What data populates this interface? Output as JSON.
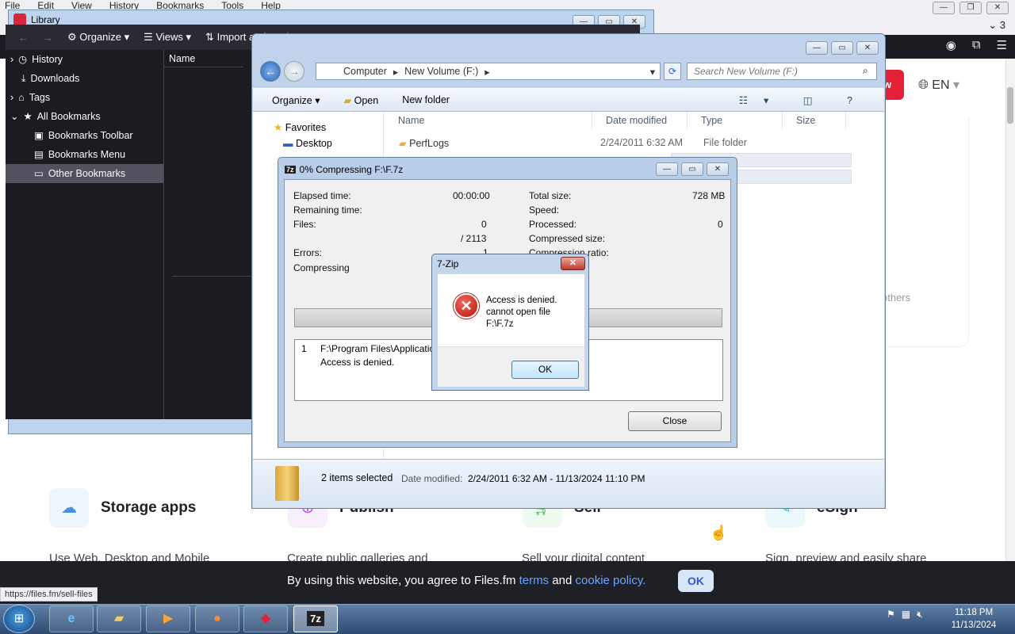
{
  "browser": {
    "menu": [
      "File",
      "Edit",
      "View",
      "History",
      "Bookmarks",
      "Tools",
      "Help"
    ],
    "tab_count": "3",
    "lang": "EN",
    "others_text": "others",
    "status_url": "https://files.fm/sell-files",
    "features": [
      {
        "title": "Storage apps",
        "desc": "Use Web, Desktop and Mobile"
      },
      {
        "title": "Publish",
        "desc": "Create public galleries and"
      },
      {
        "title": "Sell",
        "desc": "Sell your digital content"
      },
      {
        "title": "eSign",
        "desc": "Sign, preview and easily share"
      }
    ],
    "cookie": {
      "pre": "By using this website, you agree to Files.fm ",
      "terms": "terms",
      "mid": " and ",
      "policy": "cookie policy.",
      "ok": "OK"
    }
  },
  "library": {
    "title": "Library",
    "toolbar": {
      "organize": "Organize",
      "views": "Views",
      "import": "Import and Backup"
    },
    "column": "Name",
    "sidebar": [
      "History",
      "Downloads",
      "Tags",
      "All Bookmarks",
      "Bookmarks Toolbar",
      "Bookmarks Menu",
      "Other Bookmarks"
    ]
  },
  "explorer": {
    "breadcrumb": [
      "Computer",
      "New Volume (F:)"
    ],
    "search_placeholder": "Search New Volume (F:)",
    "commands": {
      "organize": "Organize",
      "open": "Open",
      "new_folder": "New folder"
    },
    "nav": {
      "favorites": "Favorites",
      "desktop": "Desktop"
    },
    "columns": [
      "Name",
      "Date modified",
      "Type",
      "Size"
    ],
    "rows": [
      {
        "name": "PerfLogs",
        "date": "2/24/2011 6:32 AM",
        "type": "File folder"
      }
    ],
    "status": {
      "selected": "2 items selected",
      "date_label": "Date modified:",
      "date_range": "2/24/2011 6:32 AM - 11/13/2024 11:10 PM"
    }
  },
  "zip_progress": {
    "title": "0% Compressing F:\\F.7z",
    "elapsed_label": "Elapsed time:",
    "elapsed": "00:00:00",
    "remaining_label": "Remaining time:",
    "files_label": "Files:",
    "files": "0",
    "files_total": "/ 2113",
    "errors_label": "Errors:",
    "errors": "1",
    "status": "Compressing",
    "total_size_label": "Total size:",
    "total_size": "728 MB",
    "speed_label": "Speed:",
    "processed_label": "Processed:",
    "processed": "0",
    "compressed_label": "Compressed size:",
    "ratio_label": "Compression ratio:",
    "progress_fraction": 0,
    "log": {
      "index": "1",
      "path": "F:\\Program Files\\Applications\\",
      "message": "Access is denied."
    },
    "close": "Close"
  },
  "error_dialog": {
    "title": "7-Zip",
    "line1": "Access is denied.",
    "line2": "cannot open file",
    "line3": "F:\\F.7z",
    "ok": "OK"
  },
  "taskbar": {
    "time": "11:18 PM",
    "date": "11/13/2024"
  }
}
